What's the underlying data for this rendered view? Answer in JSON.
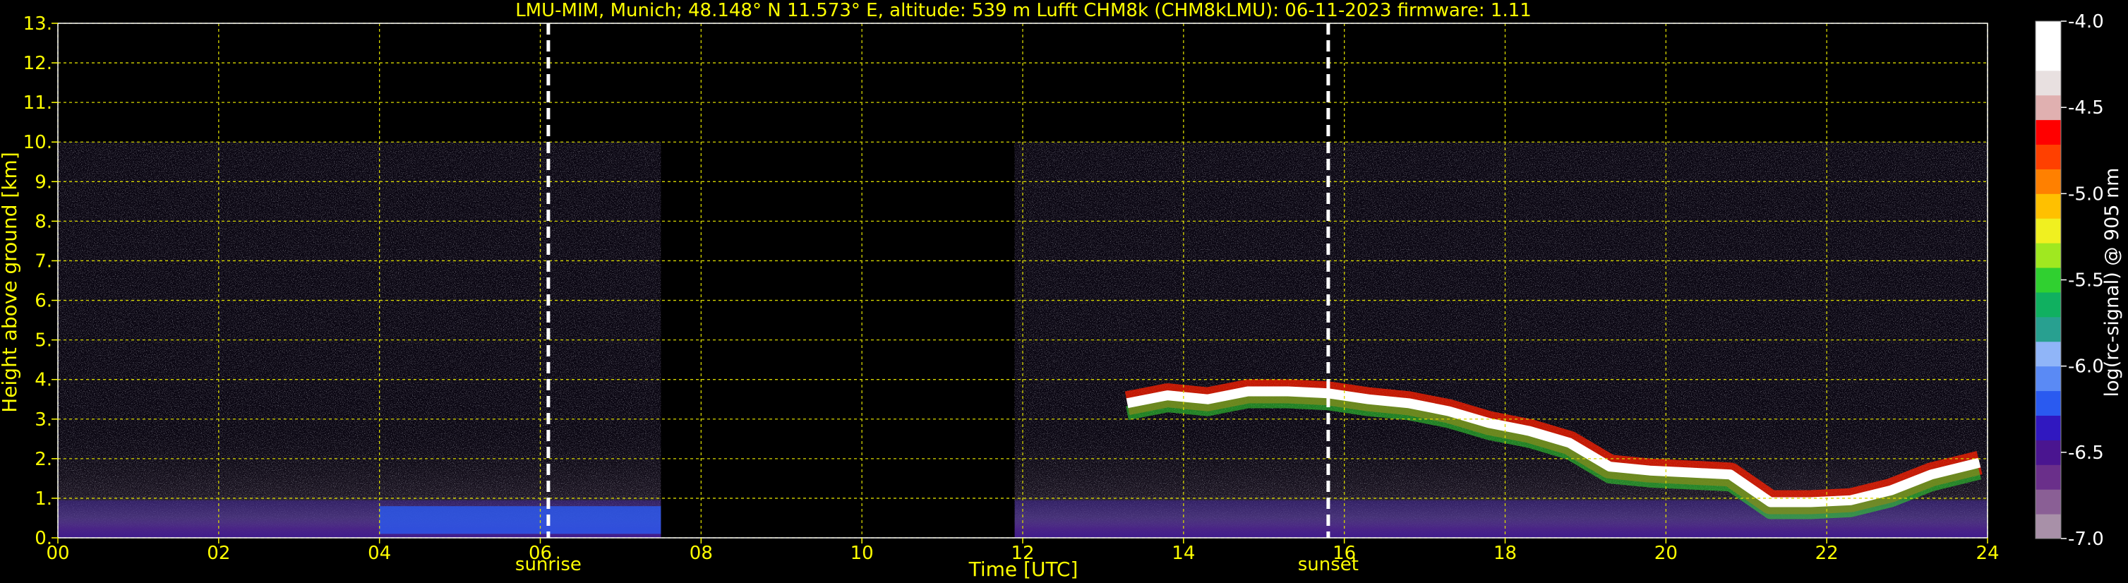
{
  "chart_data": {
    "type": "heatmap",
    "title": "LMU-MIM, Munich; 48.148° N 11.573° E, altitude: 539 m    Lufft CHM8k (CHM8kLMU): 06-11-2023    firmware: 1.11",
    "xlabel": "Time [UTC]",
    "ylabel": "Height above ground [km]",
    "xlim": [
      0,
      24
    ],
    "ylim": [
      0,
      13
    ],
    "x_ticks": [
      "00",
      "02",
      "04",
      "06",
      "08",
      "10",
      "12",
      "14",
      "16",
      "18",
      "20",
      "22",
      "24"
    ],
    "x_tick_values": [
      0,
      2,
      4,
      6,
      8,
      10,
      12,
      14,
      16,
      18,
      20,
      22,
      24
    ],
    "y_ticks": [
      "0.",
      "1.",
      "2.",
      "3.",
      "4.",
      "5.",
      "6.",
      "7.",
      "8.",
      "9.",
      "10.",
      "11.",
      "12.",
      "13."
    ],
    "y_tick_values": [
      0,
      1,
      2,
      3,
      4,
      5,
      6,
      7,
      8,
      9,
      10,
      11,
      12,
      13
    ],
    "grid": true,
    "data_gaps": [
      [
        7.5,
        11.9
      ]
    ],
    "measurement_top_km": 10,
    "events": [
      {
        "label": "sunrise",
        "time": 6.1
      },
      {
        "label": "sunset",
        "time": 15.8
      }
    ],
    "cloud_layer": [
      {
        "t": 13.3,
        "h": 3.4
      },
      {
        "t": 13.8,
        "h": 3.6
      },
      {
        "t": 14.3,
        "h": 3.5
      },
      {
        "t": 14.8,
        "h": 3.7
      },
      {
        "t": 15.3,
        "h": 3.7
      },
      {
        "t": 15.8,
        "h": 3.65
      },
      {
        "t": 16.3,
        "h": 3.5
      },
      {
        "t": 16.8,
        "h": 3.4
      },
      {
        "t": 17.3,
        "h": 3.2
      },
      {
        "t": 17.8,
        "h": 2.9
      },
      {
        "t": 18.3,
        "h": 2.7
      },
      {
        "t": 18.8,
        "h": 2.4
      },
      {
        "t": 19.3,
        "h": 1.8
      },
      {
        "t": 19.8,
        "h": 1.7
      },
      {
        "t": 20.3,
        "h": 1.65
      },
      {
        "t": 20.8,
        "h": 1.6
      },
      {
        "t": 21.3,
        "h": 0.9
      },
      {
        "t": 21.8,
        "h": 0.9
      },
      {
        "t": 22.3,
        "h": 0.95
      },
      {
        "t": 22.8,
        "h": 1.2
      },
      {
        "t": 23.3,
        "h": 1.6
      },
      {
        "t": 23.9,
        "h": 1.9
      }
    ],
    "colorbar": {
      "label": "log(rc-signal) @ 905 nm",
      "range": [
        -7.0,
        -4.0
      ],
      "ticks": [
        "-4.0",
        "-4.5",
        "-5.0",
        "-5.5",
        "-6.0",
        "-6.5",
        "-7.0"
      ],
      "tick_values": [
        -4.0,
        -4.5,
        -5.0,
        -5.5,
        -6.0,
        -6.5,
        -7.0
      ],
      "colors": [
        "#a890a8",
        "#8a5f95",
        "#6a2f8a",
        "#4a1590",
        "#3018c0",
        "#2a5af0",
        "#5a8af5",
        "#90b5f8",
        "#28a090",
        "#10b060",
        "#30d030",
        "#a0e820",
        "#f0f020",
        "#ffc000",
        "#ff8000",
        "#ff4000",
        "#ff0000",
        "#e0b0b0",
        "#e8e0e0",
        "#ffffff",
        "#ffffff"
      ]
    }
  }
}
